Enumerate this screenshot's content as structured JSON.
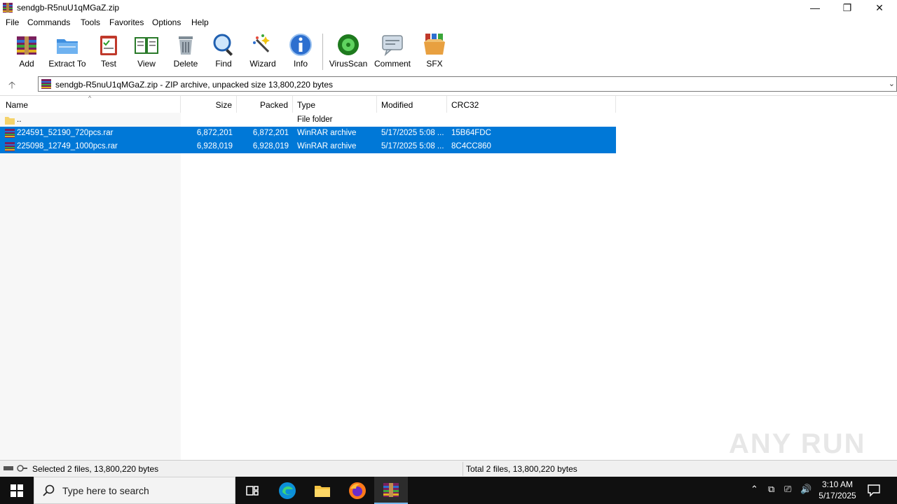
{
  "window": {
    "title": "sendgb-R5nuU1qMGaZ.zip",
    "controls": {
      "minimize": "—",
      "maximize": "❐",
      "close": "✕"
    }
  },
  "menu": [
    "File",
    "Commands",
    "Tools",
    "Favorites",
    "Options",
    "Help"
  ],
  "toolbar": [
    {
      "label": "Add",
      "icon": "add-archive-icon"
    },
    {
      "label": "Extract To",
      "icon": "extract-folder-icon"
    },
    {
      "label": "Test",
      "icon": "test-clipboard-icon"
    },
    {
      "label": "View",
      "icon": "view-book-icon"
    },
    {
      "label": "Delete",
      "icon": "trash-icon"
    },
    {
      "label": "Find",
      "icon": "magnifier-icon"
    },
    {
      "label": "Wizard",
      "icon": "wand-icon"
    },
    {
      "label": "Info",
      "icon": "info-icon"
    },
    {
      "label": "VirusScan",
      "icon": "virus-scan-icon"
    },
    {
      "label": "Comment",
      "icon": "comment-icon"
    },
    {
      "label": "SFX",
      "icon": "sfx-box-icon"
    }
  ],
  "address": {
    "text": "sendgb-R5nuU1qMGaZ.zip - ZIP archive, unpacked size 13,800,220 bytes"
  },
  "columns": {
    "name": "Name",
    "size": "Size",
    "packed": "Packed",
    "type": "Type",
    "modified": "Modified",
    "crc": "CRC32"
  },
  "rows": [
    {
      "name": "..",
      "size": "",
      "packed": "",
      "type": "File folder",
      "modified": "",
      "crc": ""
    },
    {
      "name": "224591_52190_720pcs.rar",
      "size": "6,872,201",
      "packed": "6,872,201",
      "type": "WinRAR archive",
      "modified": "5/17/2025 5:08 ...",
      "crc": "15B64FDC"
    },
    {
      "name": "225098_12749_1000pcs.rar",
      "size": "6,928,019",
      "packed": "6,928,019",
      "type": "WinRAR archive",
      "modified": "5/17/2025 5:08 ...",
      "crc": "8C4CC860"
    }
  ],
  "status": {
    "left": "Selected 2 files, 13,800,220 bytes",
    "right": "Total 2 files, 13,800,220 bytes"
  },
  "watermark": "ANY RUN",
  "taskbar": {
    "search_placeholder": "Type here to search",
    "time": "3:10 AM",
    "date": "5/17/2025"
  },
  "colors": {
    "selection": "#0078d7",
    "taskbar": "#101010"
  }
}
